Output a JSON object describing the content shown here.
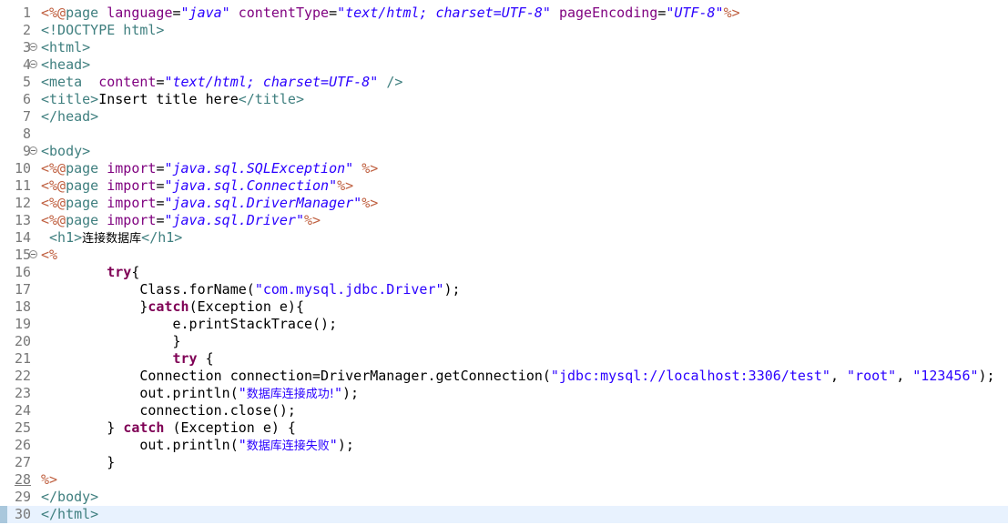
{
  "lines": [
    {
      "n": "1",
      "spans": [
        [
          "jsp",
          "<%@"
        ],
        [
          "tag",
          "page "
        ],
        [
          "attr",
          "language"
        ],
        [
          "",
          "="
        ],
        [
          "val",
          "\"java\""
        ],
        [
          "",
          " "
        ],
        [
          "attr",
          "contentType"
        ],
        [
          "",
          "="
        ],
        [
          "val",
          "\"text/html; charset=UTF-8\""
        ],
        [
          "",
          " "
        ],
        [
          "attr",
          "pageEncoding"
        ],
        [
          "",
          "="
        ],
        [
          "val",
          "\"UTF-8\""
        ],
        [
          "jsp",
          "%>"
        ]
      ]
    },
    {
      "n": "2",
      "spans": [
        [
          "tag",
          "<!DOCTYPE html>"
        ]
      ]
    },
    {
      "n": "3",
      "fold": true,
      "spans": [
        [
          "tag",
          "<html>"
        ]
      ]
    },
    {
      "n": "4",
      "fold": true,
      "spans": [
        [
          "tag",
          "<head>"
        ]
      ]
    },
    {
      "n": "5",
      "spans": [
        [
          "tag",
          "<meta"
        ],
        [
          "",
          "  "
        ],
        [
          "attr",
          "content"
        ],
        [
          "",
          "="
        ],
        [
          "val",
          "\"text/html; charset=UTF-8\""
        ],
        [
          "",
          " "
        ],
        [
          "tag",
          "/>"
        ]
      ]
    },
    {
      "n": "6",
      "spans": [
        [
          "tag",
          "<title>"
        ],
        [
          "",
          "Insert title here"
        ],
        [
          "tag",
          "</title>"
        ]
      ]
    },
    {
      "n": "7",
      "spans": [
        [
          "tag",
          "</head>"
        ]
      ]
    },
    {
      "n": "8",
      "spans": []
    },
    {
      "n": "9",
      "fold": true,
      "spans": [
        [
          "tag",
          "<body>"
        ]
      ]
    },
    {
      "n": "10",
      "spans": [
        [
          "jsp",
          "<%@"
        ],
        [
          "tag",
          "page "
        ],
        [
          "attr",
          "import"
        ],
        [
          "",
          "="
        ],
        [
          "val",
          "\"java.sql.SQLException\""
        ],
        [
          "",
          " "
        ],
        [
          "jsp",
          "%>"
        ]
      ]
    },
    {
      "n": "11",
      "spans": [
        [
          "jsp",
          "<%@"
        ],
        [
          "tag",
          "page "
        ],
        [
          "attr",
          "import"
        ],
        [
          "",
          "="
        ],
        [
          "val",
          "\"java.sql.Connection\""
        ],
        [
          "jsp",
          "%>"
        ]
      ]
    },
    {
      "n": "12",
      "spans": [
        [
          "jsp",
          "<%@"
        ],
        [
          "tag",
          "page "
        ],
        [
          "attr",
          "import"
        ],
        [
          "",
          "="
        ],
        [
          "val",
          "\"java.sql.DriverManager\""
        ],
        [
          "jsp",
          "%>"
        ]
      ]
    },
    {
      "n": "13",
      "spans": [
        [
          "jsp",
          "<%@"
        ],
        [
          "tag",
          "page "
        ],
        [
          "attr",
          "import"
        ],
        [
          "",
          "="
        ],
        [
          "val",
          "\"java.sql.Driver\""
        ],
        [
          "jsp",
          "%>"
        ]
      ]
    },
    {
      "n": "14",
      "spans": [
        [
          "",
          " "
        ],
        [
          "tag",
          "<h1>"
        ],
        [
          "cjk",
          "连接数据库"
        ],
        [
          "tag",
          "</h1>"
        ]
      ]
    },
    {
      "n": "15",
      "fold": true,
      "spans": [
        [
          "jsp",
          "<%"
        ]
      ]
    },
    {
      "n": "16",
      "spans": [
        [
          "",
          "        "
        ],
        [
          "k",
          "try"
        ],
        [
          "",
          "{"
        ]
      ]
    },
    {
      "n": "17",
      "spans": [
        [
          "",
          "            Class.forName("
        ],
        [
          "s",
          "\"com.mysql.jdbc.Driver\""
        ],
        [
          "",
          ");"
        ]
      ]
    },
    {
      "n": "18",
      "spans": [
        [
          "",
          "            }"
        ],
        [
          "k",
          "catch"
        ],
        [
          "",
          "(Exception e){"
        ]
      ]
    },
    {
      "n": "19",
      "spans": [
        [
          "",
          "                e.printStackTrace();"
        ]
      ]
    },
    {
      "n": "20",
      "spans": [
        [
          "",
          "                }"
        ]
      ]
    },
    {
      "n": "21",
      "spans": [
        [
          "",
          "                "
        ],
        [
          "k",
          "try"
        ],
        [
          "",
          " {"
        ]
      ]
    },
    {
      "n": "22",
      "spans": [
        [
          "",
          "            Connection connection=DriverManager.getConnection("
        ],
        [
          "s",
          "\"jdbc:mysql://localhost:3306/test\""
        ],
        [
          "",
          ", "
        ],
        [
          "s",
          "\"root\""
        ],
        [
          "",
          ", "
        ],
        [
          "s",
          "\"123456\""
        ],
        [
          "",
          ");"
        ]
      ]
    },
    {
      "n": "23",
      "spans": [
        [
          "",
          "            out.println("
        ],
        [
          "s",
          "\""
        ],
        [
          "s cjk",
          "数据库连接成功!"
        ],
        [
          "s",
          "\""
        ],
        [
          "",
          ");"
        ]
      ]
    },
    {
      "n": "24",
      "spans": [
        [
          "",
          "            connection.close();"
        ]
      ]
    },
    {
      "n": "25",
      "spans": [
        [
          "",
          "        } "
        ],
        [
          "k",
          "catch"
        ],
        [
          "",
          " (Exception e) {"
        ]
      ]
    },
    {
      "n": "26",
      "spans": [
        [
          "",
          "            out.println("
        ],
        [
          "s",
          "\""
        ],
        [
          "s cjk",
          "数据库连接失败"
        ],
        [
          "s",
          "\""
        ],
        [
          "",
          ");"
        ]
      ]
    },
    {
      "n": "27",
      "spans": [
        [
          "",
          "        }"
        ]
      ]
    },
    {
      "n": "28",
      "underline": true,
      "spans": [
        [
          "jsp",
          "%>"
        ]
      ]
    },
    {
      "n": "29",
      "spans": [
        [
          "tag",
          "</body>"
        ]
      ]
    },
    {
      "n": "30",
      "current": true,
      "spans": [
        [
          "tag",
          "</html>"
        ]
      ]
    }
  ]
}
